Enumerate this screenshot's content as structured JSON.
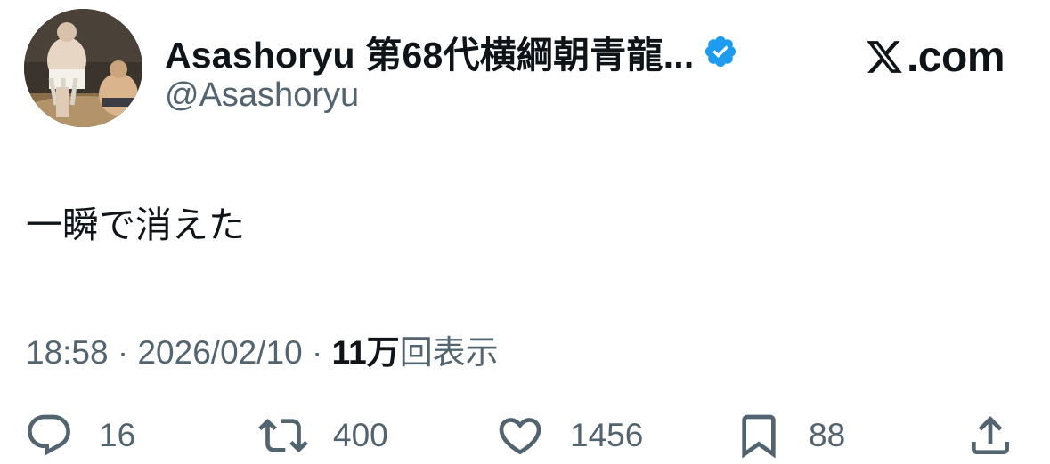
{
  "user": {
    "display_name": "Asashoryu 第68代横綱朝青龍...",
    "handle": "@Asashoryu",
    "verified_icon": "verified-badge-icon"
  },
  "brand": {
    "logo_icon": "x-logo-icon",
    "text": ".com"
  },
  "tweet": {
    "text": "一瞬で消えた",
    "time": "18:58",
    "sep1": " · ",
    "date": "2026/02/10",
    "sep2": " · ",
    "views_count": "11万",
    "views_label": "回表示"
  },
  "actions": {
    "reply": {
      "icon": "reply-icon",
      "count": "16"
    },
    "retweet": {
      "icon": "retweet-icon",
      "count": "400"
    },
    "like": {
      "icon": "heart-icon",
      "count": "1456"
    },
    "bookmark": {
      "icon": "bookmark-icon",
      "count": "88"
    },
    "share": {
      "icon": "share-icon"
    }
  },
  "colors": {
    "text": "#0f1419",
    "secondary": "#536471",
    "verified": "#1d9bf0"
  }
}
